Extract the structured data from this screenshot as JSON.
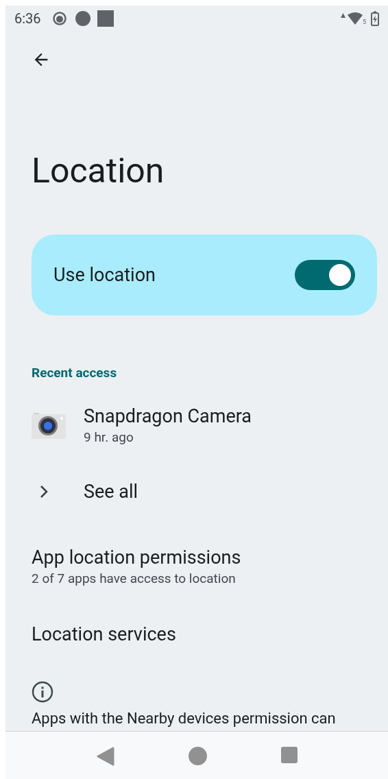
{
  "status_bar": {
    "time": "6:36",
    "signal_badge": "5"
  },
  "title": "Location",
  "use_location": {
    "label": "Use location",
    "on": true
  },
  "recent_access": {
    "heading": "Recent access",
    "apps": [
      {
        "name": "Snapdragon Camera",
        "time": "9 hr. ago"
      }
    ],
    "see_all": "See all"
  },
  "settings": [
    {
      "title": "App location permissions",
      "summary": "2 of 7 apps have access to location"
    },
    {
      "title": "Location services"
    }
  ],
  "footer_text": "Apps with the Nearby devices permission can"
}
